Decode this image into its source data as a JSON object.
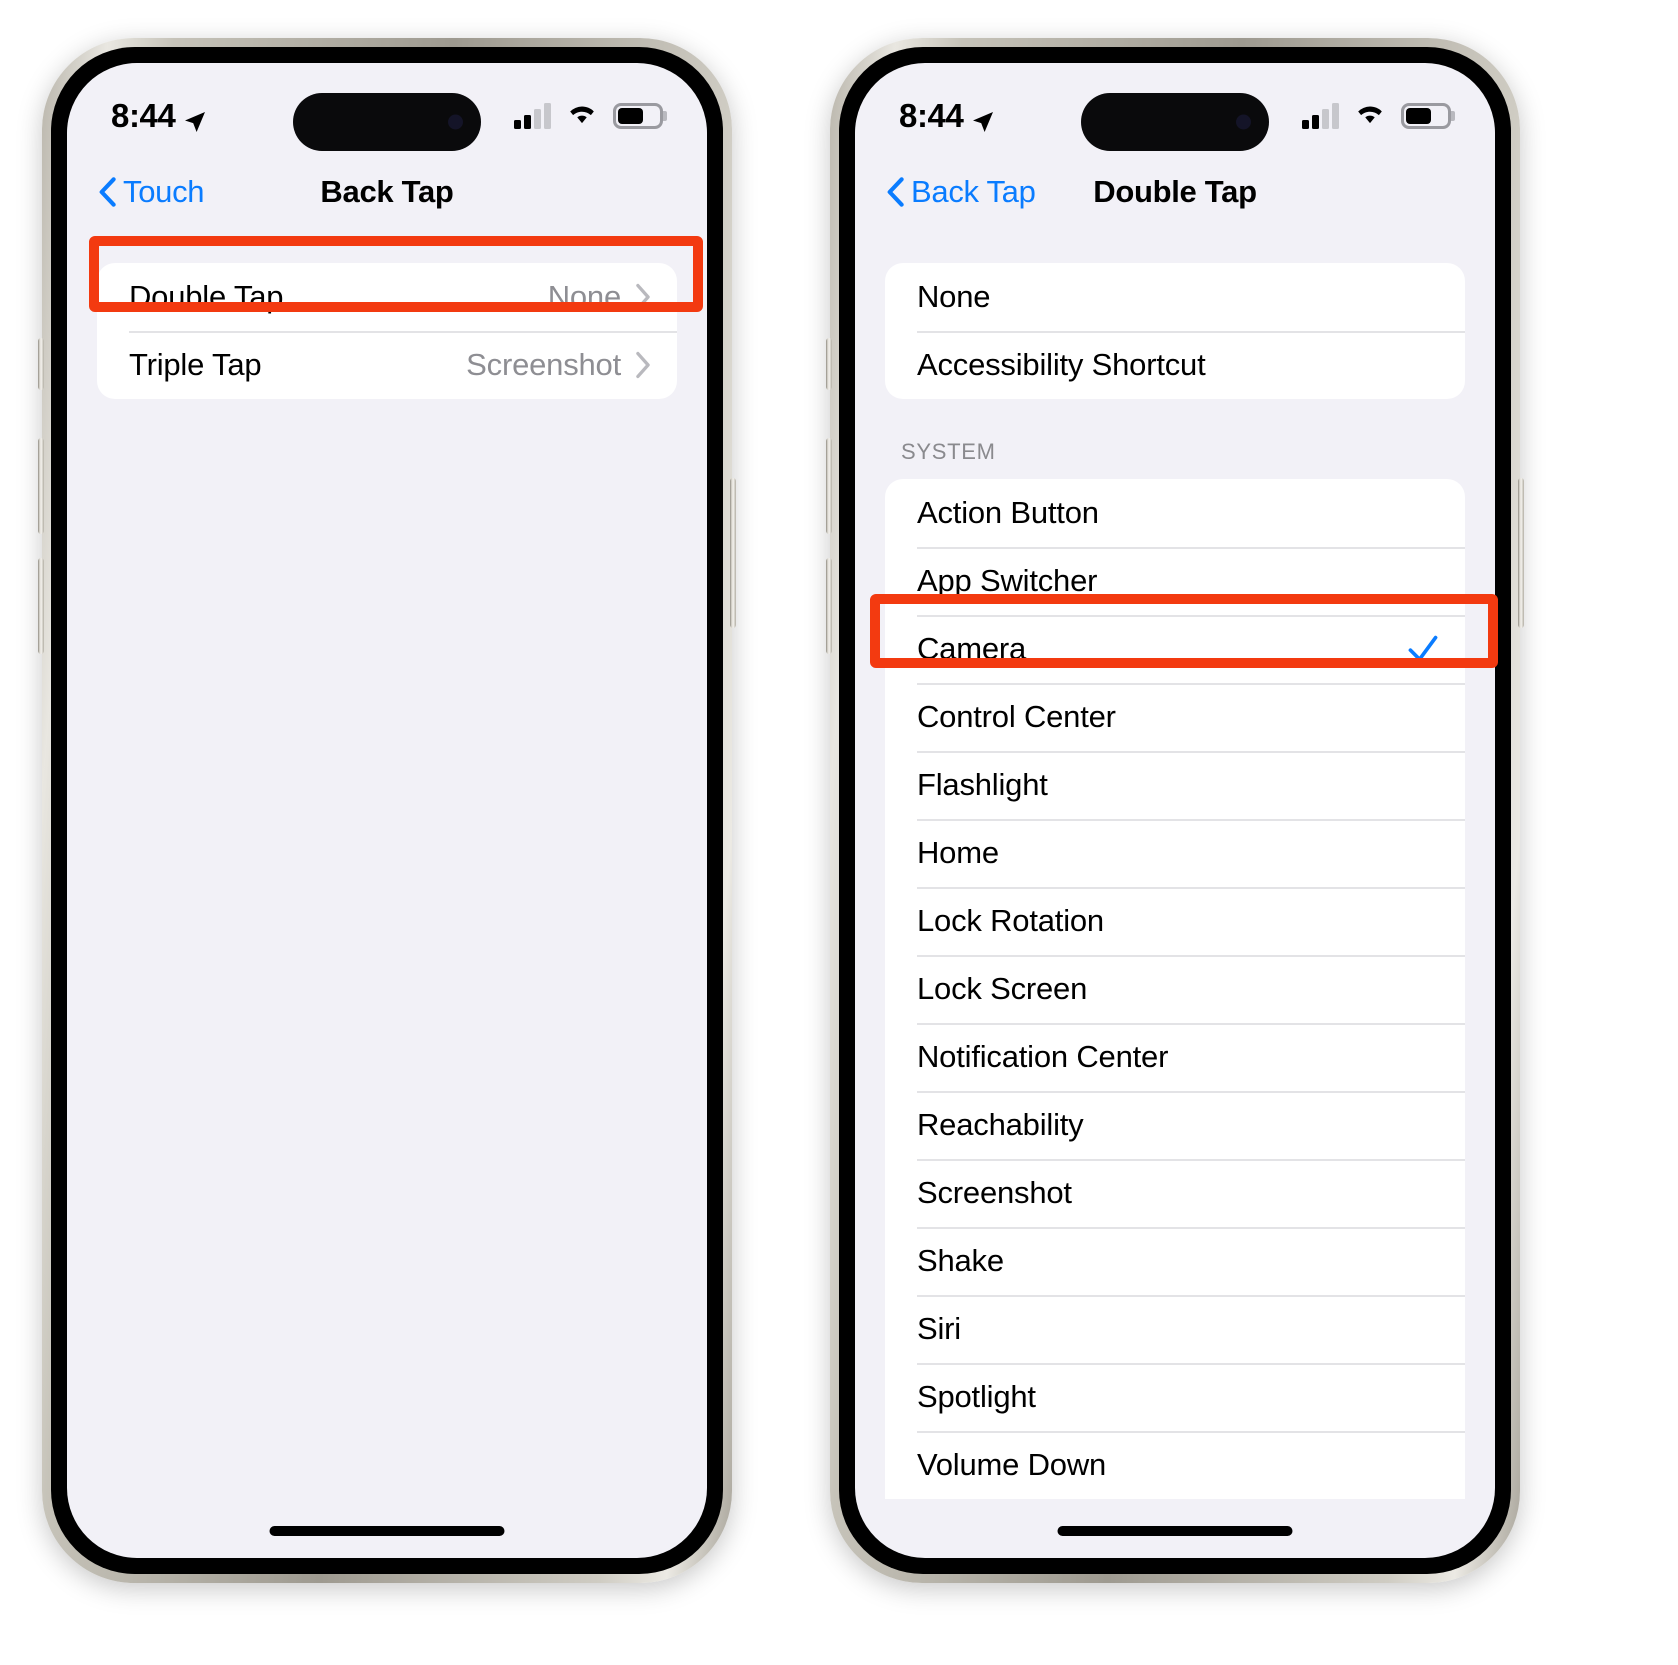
{
  "status_bar": {
    "time": "8:44",
    "location_icon": "location-arrow-icon",
    "cellular_icon": "cellular-signal-icon",
    "wifi_icon": "wifi-icon",
    "battery_icon": "battery-icon"
  },
  "left_phone": {
    "nav": {
      "back_label": "Touch",
      "title": "Back Tap",
      "back_icon": "chevron-left-icon"
    },
    "rows": [
      {
        "label": "Double Tap",
        "value": "None",
        "accessory": "chevron-right-icon",
        "highlighted": true
      },
      {
        "label": "Triple Tap",
        "value": "Screenshot",
        "accessory": "chevron-right-icon",
        "highlighted": false
      }
    ]
  },
  "right_phone": {
    "nav": {
      "back_label": "Back Tap",
      "title": "Double Tap",
      "back_icon": "chevron-left-icon"
    },
    "top_group": [
      {
        "label": "None",
        "selected": false
      },
      {
        "label": "Accessibility Shortcut",
        "selected": false
      }
    ],
    "section_header": "SYSTEM",
    "system_group": [
      {
        "label": "Action Button",
        "selected": false
      },
      {
        "label": "App Switcher",
        "selected": false
      },
      {
        "label": "Camera",
        "selected": true
      },
      {
        "label": "Control Center",
        "selected": false
      },
      {
        "label": "Flashlight",
        "selected": false
      },
      {
        "label": "Home",
        "selected": false
      },
      {
        "label": "Lock Rotation",
        "selected": false
      },
      {
        "label": "Lock Screen",
        "selected": false
      },
      {
        "label": "Notification Center",
        "selected": false
      },
      {
        "label": "Reachability",
        "selected": false
      },
      {
        "label": "Screenshot",
        "selected": false
      },
      {
        "label": "Shake",
        "selected": false
      },
      {
        "label": "Siri",
        "selected": false
      },
      {
        "label": "Spotlight",
        "selected": false
      },
      {
        "label": "Volume Down",
        "selected": false
      }
    ]
  },
  "colors": {
    "accent_blue": "#0a7cff",
    "highlight_red": "#f33a10",
    "screen_bg": "#f2f1f7",
    "row_bg": "#ffffff",
    "secondary_text": "#8e8e93"
  }
}
